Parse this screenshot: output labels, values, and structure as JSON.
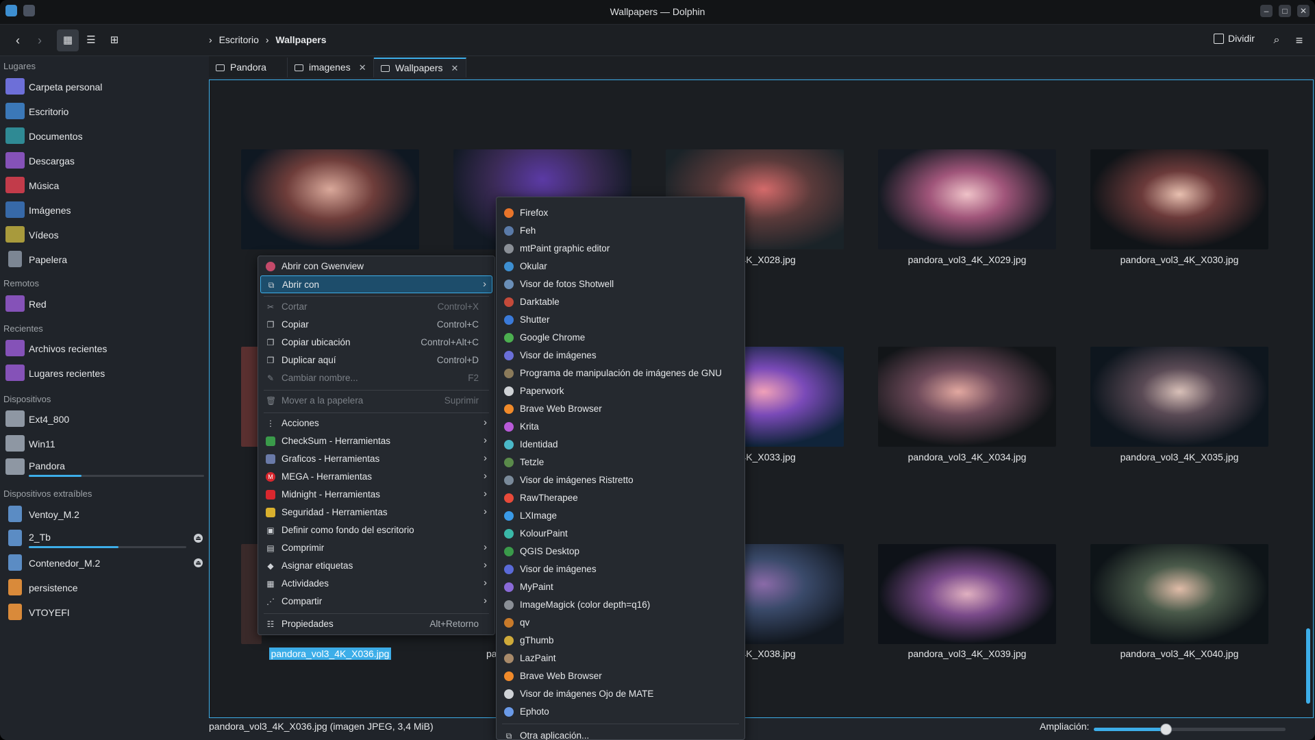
{
  "window": {
    "title": "Wallpapers — Dolphin"
  },
  "toolbar": {
    "breadcrumb": [
      "Escritorio",
      "Wallpapers"
    ],
    "split_label": "Dividir"
  },
  "sidebar": {
    "places_header": "Lugares",
    "places": [
      "Carpeta personal",
      "Escritorio",
      "Documentos",
      "Descargas",
      "Música",
      "Imágenes",
      "Vídeos",
      "Papelera"
    ],
    "remote_header": "Remotos",
    "remote": [
      "Red"
    ],
    "recent_header": "Recientes",
    "recent": [
      "Archivos recientes",
      "Lugares recientes"
    ],
    "devices_header": "Dispositivos",
    "devices": [
      "Ext4_800",
      "Win11",
      "Pandora"
    ],
    "removable_header": "Dispositivos extraíbles",
    "removable": [
      "Ventoy_M.2",
      "2_Tb",
      "Contenedor_M.2",
      "persistence",
      "VTOYEFI"
    ],
    "pandora_usage": 0.3,
    "tb2_usage": 0.57
  },
  "tabs": [
    "Pandora",
    "imagenes",
    "Wallpapers"
  ],
  "files": [
    "ol3_4K_X028.jpg",
    "pandora_vol3_4K_X029.jpg",
    "pandora_vol3_4K_X030.jpg",
    "ol3_4K_X033.jpg",
    "pandora_vol3_4K_X034.jpg",
    "pandora_vol3_4K_X035.jpg",
    "pandora_vol3_4K_X036.jpg",
    "pa",
    "ol3_4K_X038.jpg",
    "pandora_vol3_4K_X039.jpg",
    "pandora_vol3_4K_X040.jpg"
  ],
  "context_menu": {
    "items": [
      {
        "label": "Abrir con Gwenview"
      },
      {
        "label": "Abrir con"
      },
      {
        "label": "Cortar",
        "shortcut": "Control+X"
      },
      {
        "label": "Copiar",
        "shortcut": "Control+C"
      },
      {
        "label": "Copiar ubicación",
        "shortcut": "Control+Alt+C"
      },
      {
        "label": "Duplicar aquí",
        "shortcut": "Control+D"
      },
      {
        "label": "Cambiar nombre...",
        "shortcut": "F2"
      },
      {
        "label": "Mover a la papelera",
        "shortcut": "Suprimir"
      },
      {
        "label": "Acciones"
      },
      {
        "label": "CheckSum - Herramientas"
      },
      {
        "label": "Graficos - Herramientas"
      },
      {
        "label": "MEGA - Herramientas"
      },
      {
        "label": "Midnight - Herramientas"
      },
      {
        "label": "Seguridad - Herramientas"
      },
      {
        "label": "Definir como fondo del escritorio"
      },
      {
        "label": "Comprimir"
      },
      {
        "label": "Asignar etiquetas"
      },
      {
        "label": "Actividades"
      },
      {
        "label": "Compartir"
      },
      {
        "label": "Propiedades",
        "shortcut": "Alt+Retorno"
      }
    ]
  },
  "open_with_menu": {
    "apps": [
      "Firefox",
      "Feh",
      "mtPaint graphic editor",
      "Okular",
      "Visor de fotos Shotwell",
      "Darktable",
      "Shutter",
      "Google Chrome",
      "Visor de imágenes",
      "Programa de manipulación de imágenes de GNU",
      "Paperwork",
      "Brave Web Browser",
      "Krita",
      "Identidad",
      "Tetzle",
      "Visor de imágenes Ristretto",
      "RawTherapee",
      "LXImage",
      "KolourPaint",
      "QGIS Desktop",
      "Visor de imágenes",
      "MyPaint",
      "ImageMagick (color depth=q16)",
      "qv",
      "gThumb",
      "LazPaint",
      "Brave Web Browser",
      "Visor de imágenes Ojo de MATE",
      "Ephoto"
    ],
    "other": "Otra aplicación..."
  },
  "statusbar": {
    "info": "pandora_vol3_4K_X036.jpg (imagen JPEG, 3,4 MiB)",
    "zoom_label": "Ampliación:"
  }
}
